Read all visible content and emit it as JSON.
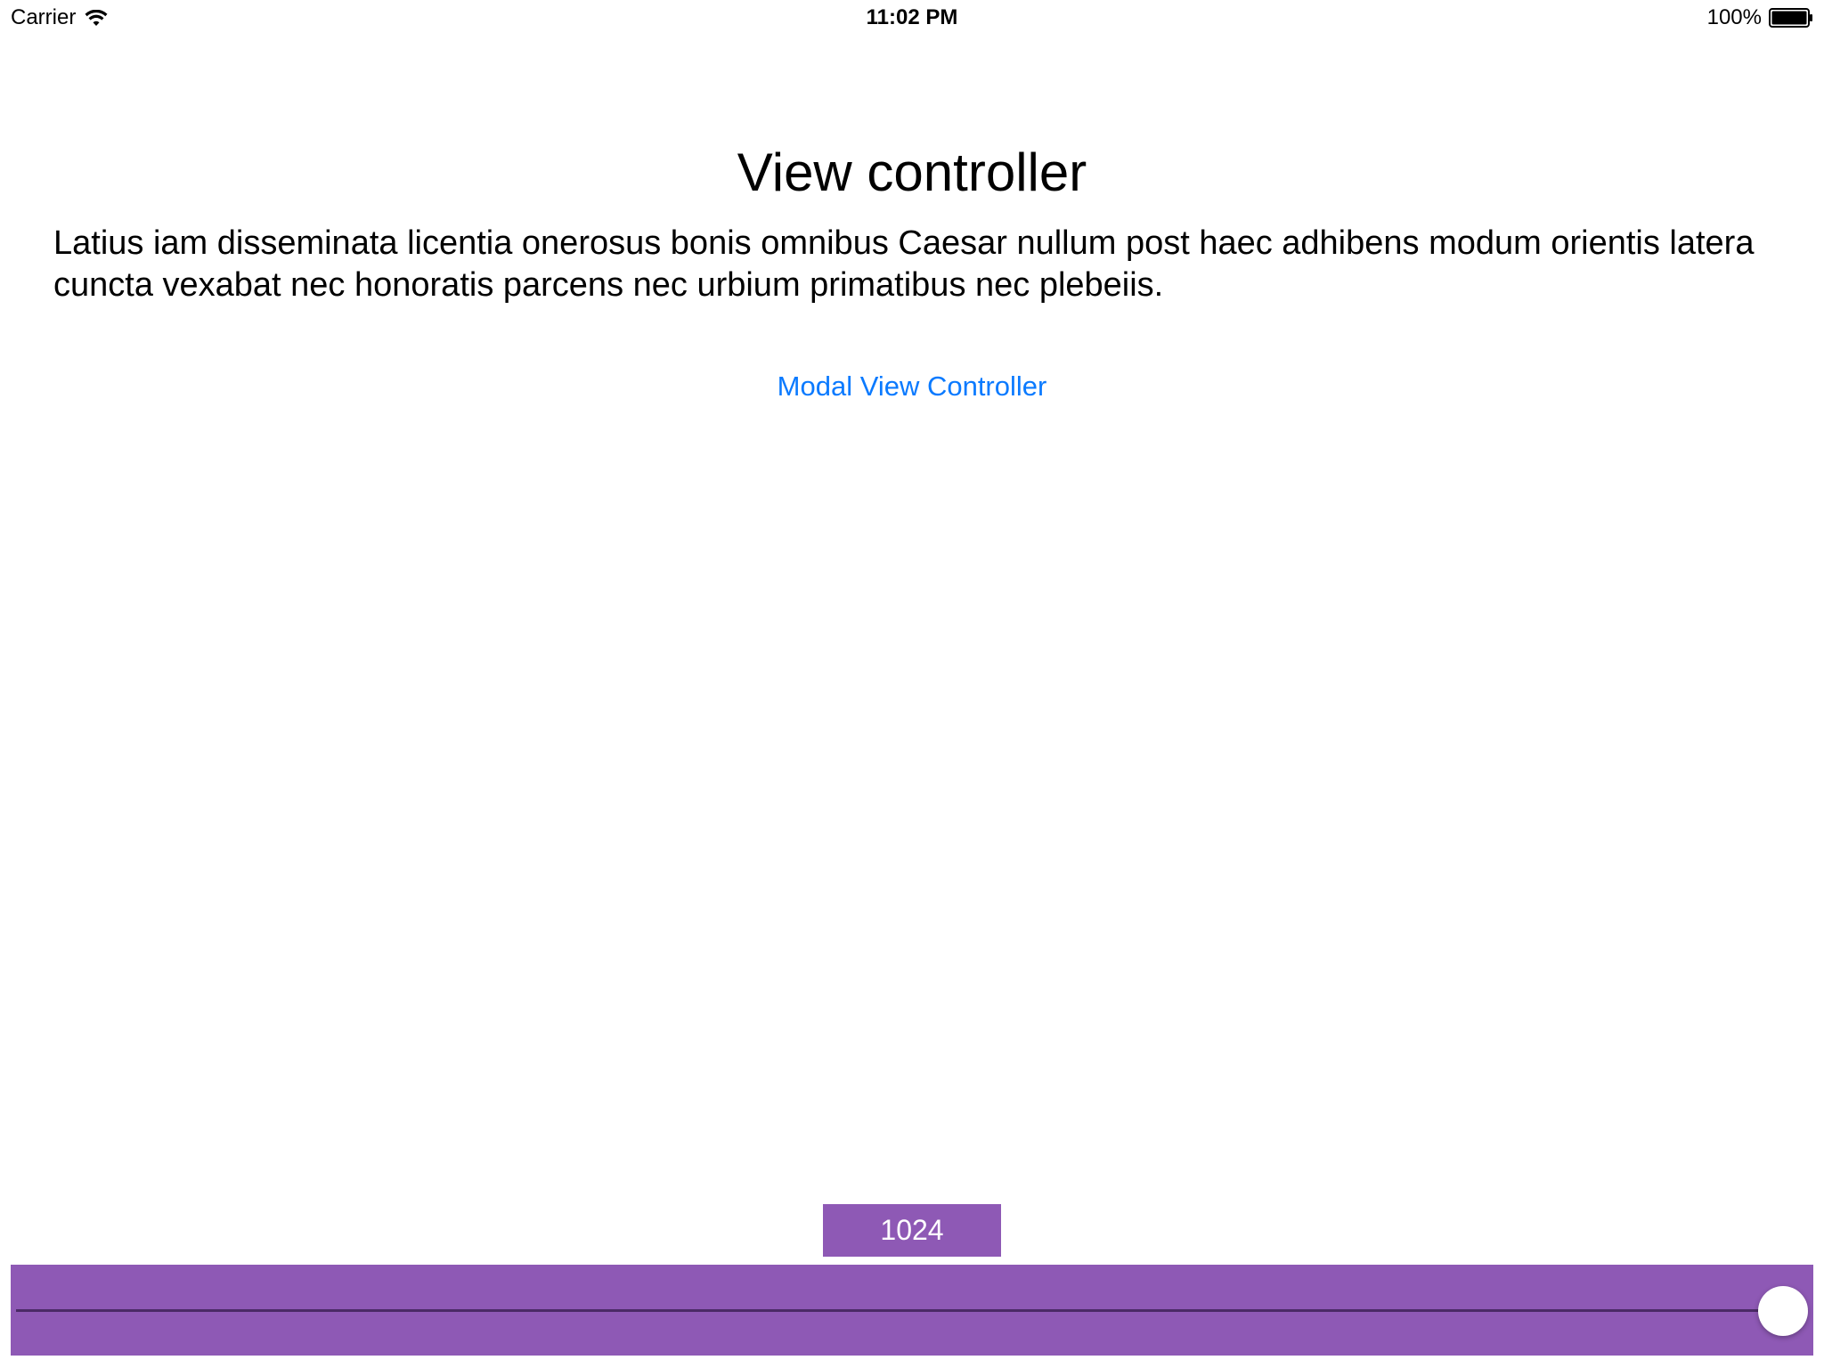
{
  "status_bar": {
    "carrier": "Carrier",
    "time": "11:02 PM",
    "battery_percent": "100%",
    "wifi_icon": "wifi-icon",
    "battery_icon": "battery-icon"
  },
  "content": {
    "title": "View controller",
    "body": "Latius iam disseminata licentia onerosus bonis omnibus Caesar nullum post haec adhibens modum orientis latera cuncta vexabat nec honoratis parcens nec urbium primatibus nec plebeiis.",
    "modal_link_label": "Modal View Controller"
  },
  "slider": {
    "value_label": "1024",
    "fraction": 1.0
  },
  "colors": {
    "accent_link": "#0a7aff",
    "slider_background": "#8e59b5",
    "slider_track": "#4a2a66"
  }
}
